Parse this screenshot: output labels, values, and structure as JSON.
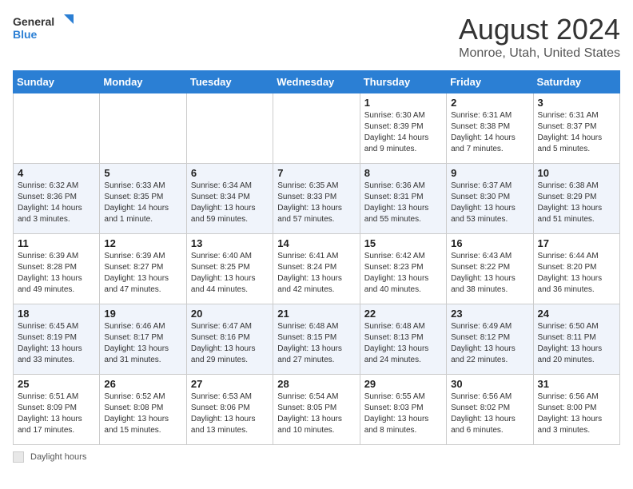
{
  "header": {
    "logo_general": "General",
    "logo_blue": "Blue",
    "month": "August 2024",
    "location": "Monroe, Utah, United States"
  },
  "days_of_week": [
    "Sunday",
    "Monday",
    "Tuesday",
    "Wednesday",
    "Thursday",
    "Friday",
    "Saturday"
  ],
  "weeks": [
    [
      {
        "day": "",
        "info": ""
      },
      {
        "day": "",
        "info": ""
      },
      {
        "day": "",
        "info": ""
      },
      {
        "day": "",
        "info": ""
      },
      {
        "day": "1",
        "info": "Sunrise: 6:30 AM\nSunset: 8:39 PM\nDaylight: 14 hours and 9 minutes."
      },
      {
        "day": "2",
        "info": "Sunrise: 6:31 AM\nSunset: 8:38 PM\nDaylight: 14 hours and 7 minutes."
      },
      {
        "day": "3",
        "info": "Sunrise: 6:31 AM\nSunset: 8:37 PM\nDaylight: 14 hours and 5 minutes."
      }
    ],
    [
      {
        "day": "4",
        "info": "Sunrise: 6:32 AM\nSunset: 8:36 PM\nDaylight: 14 hours and 3 minutes."
      },
      {
        "day": "5",
        "info": "Sunrise: 6:33 AM\nSunset: 8:35 PM\nDaylight: 14 hours and 1 minute."
      },
      {
        "day": "6",
        "info": "Sunrise: 6:34 AM\nSunset: 8:34 PM\nDaylight: 13 hours and 59 minutes."
      },
      {
        "day": "7",
        "info": "Sunrise: 6:35 AM\nSunset: 8:33 PM\nDaylight: 13 hours and 57 minutes."
      },
      {
        "day": "8",
        "info": "Sunrise: 6:36 AM\nSunset: 8:31 PM\nDaylight: 13 hours and 55 minutes."
      },
      {
        "day": "9",
        "info": "Sunrise: 6:37 AM\nSunset: 8:30 PM\nDaylight: 13 hours and 53 minutes."
      },
      {
        "day": "10",
        "info": "Sunrise: 6:38 AM\nSunset: 8:29 PM\nDaylight: 13 hours and 51 minutes."
      }
    ],
    [
      {
        "day": "11",
        "info": "Sunrise: 6:39 AM\nSunset: 8:28 PM\nDaylight: 13 hours and 49 minutes."
      },
      {
        "day": "12",
        "info": "Sunrise: 6:39 AM\nSunset: 8:27 PM\nDaylight: 13 hours and 47 minutes."
      },
      {
        "day": "13",
        "info": "Sunrise: 6:40 AM\nSunset: 8:25 PM\nDaylight: 13 hours and 44 minutes."
      },
      {
        "day": "14",
        "info": "Sunrise: 6:41 AM\nSunset: 8:24 PM\nDaylight: 13 hours and 42 minutes."
      },
      {
        "day": "15",
        "info": "Sunrise: 6:42 AM\nSunset: 8:23 PM\nDaylight: 13 hours and 40 minutes."
      },
      {
        "day": "16",
        "info": "Sunrise: 6:43 AM\nSunset: 8:22 PM\nDaylight: 13 hours and 38 minutes."
      },
      {
        "day": "17",
        "info": "Sunrise: 6:44 AM\nSunset: 8:20 PM\nDaylight: 13 hours and 36 minutes."
      }
    ],
    [
      {
        "day": "18",
        "info": "Sunrise: 6:45 AM\nSunset: 8:19 PM\nDaylight: 13 hours and 33 minutes."
      },
      {
        "day": "19",
        "info": "Sunrise: 6:46 AM\nSunset: 8:17 PM\nDaylight: 13 hours and 31 minutes."
      },
      {
        "day": "20",
        "info": "Sunrise: 6:47 AM\nSunset: 8:16 PM\nDaylight: 13 hours and 29 minutes."
      },
      {
        "day": "21",
        "info": "Sunrise: 6:48 AM\nSunset: 8:15 PM\nDaylight: 13 hours and 27 minutes."
      },
      {
        "day": "22",
        "info": "Sunrise: 6:48 AM\nSunset: 8:13 PM\nDaylight: 13 hours and 24 minutes."
      },
      {
        "day": "23",
        "info": "Sunrise: 6:49 AM\nSunset: 8:12 PM\nDaylight: 13 hours and 22 minutes."
      },
      {
        "day": "24",
        "info": "Sunrise: 6:50 AM\nSunset: 8:11 PM\nDaylight: 13 hours and 20 minutes."
      }
    ],
    [
      {
        "day": "25",
        "info": "Sunrise: 6:51 AM\nSunset: 8:09 PM\nDaylight: 13 hours and 17 minutes."
      },
      {
        "day": "26",
        "info": "Sunrise: 6:52 AM\nSunset: 8:08 PM\nDaylight: 13 hours and 15 minutes."
      },
      {
        "day": "27",
        "info": "Sunrise: 6:53 AM\nSunset: 8:06 PM\nDaylight: 13 hours and 13 minutes."
      },
      {
        "day": "28",
        "info": "Sunrise: 6:54 AM\nSunset: 8:05 PM\nDaylight: 13 hours and 10 minutes."
      },
      {
        "day": "29",
        "info": "Sunrise: 6:55 AM\nSunset: 8:03 PM\nDaylight: 13 hours and 8 minutes."
      },
      {
        "day": "30",
        "info": "Sunrise: 6:56 AM\nSunset: 8:02 PM\nDaylight: 13 hours and 6 minutes."
      },
      {
        "day": "31",
        "info": "Sunrise: 6:56 AM\nSunset: 8:00 PM\nDaylight: 13 hours and 3 minutes."
      }
    ]
  ],
  "footer": {
    "legend_label": "Daylight hours"
  }
}
